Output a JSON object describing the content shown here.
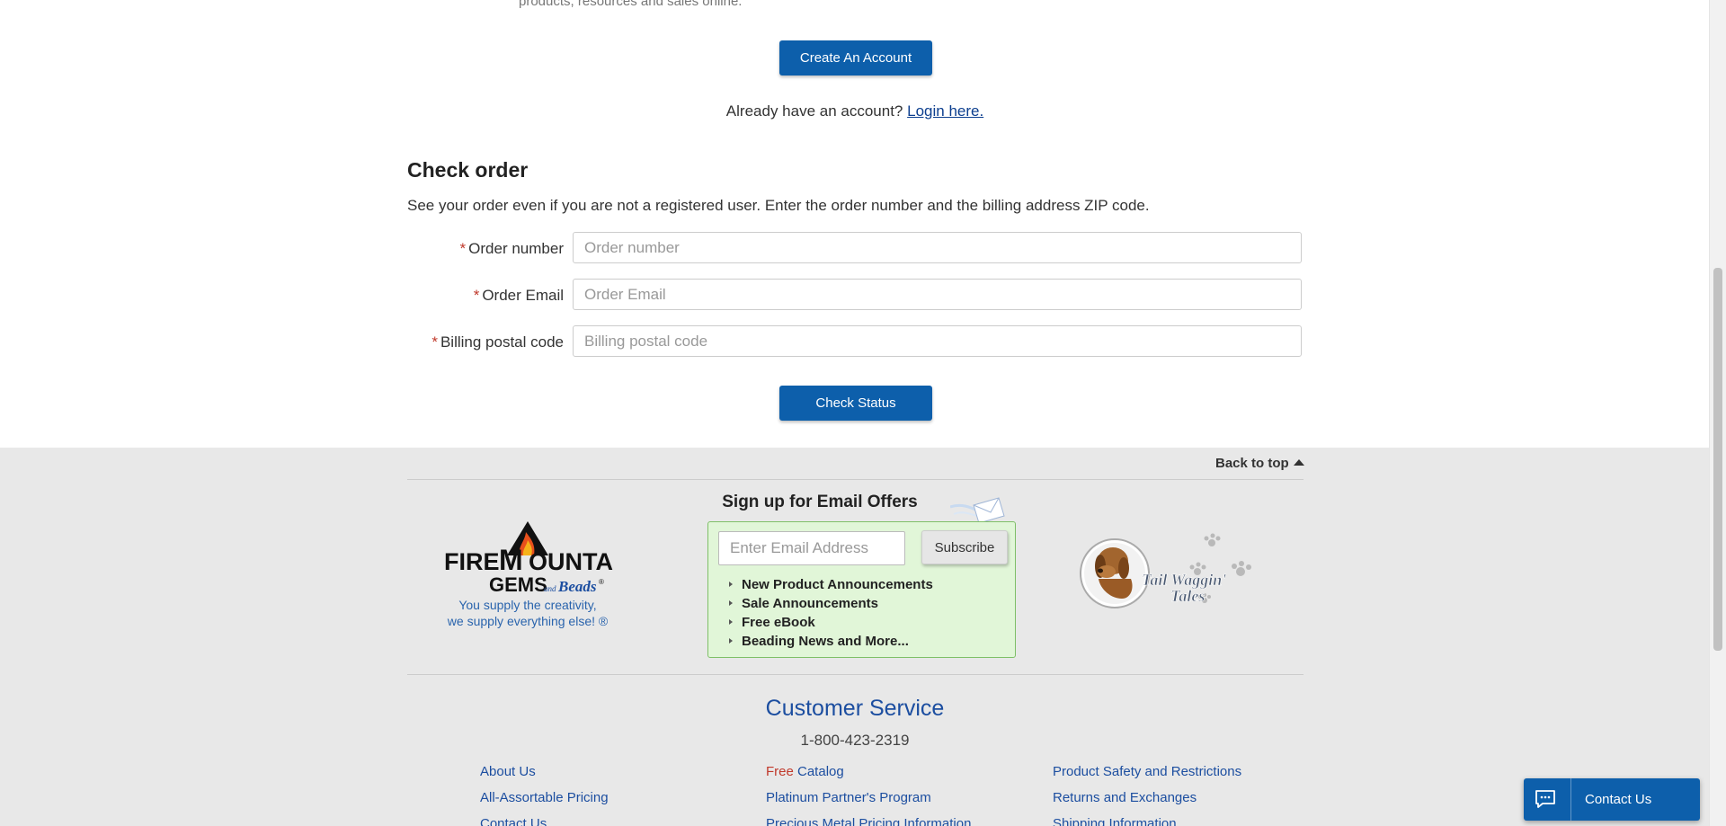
{
  "intro": {
    "text": "products, resources and sales online."
  },
  "account": {
    "create_button": "Create An Account",
    "already_text": "Already have an account?",
    "login_link": "Login here."
  },
  "check_order": {
    "title": "Check order",
    "description": "See your order even if you are not a registered user. Enter the order number and the billing address ZIP code.",
    "required_mark": "*",
    "fields": [
      {
        "label": "Order number",
        "placeholder": "Order number",
        "value": ""
      },
      {
        "label": "Order Email",
        "placeholder": "Order Email",
        "value": ""
      },
      {
        "label": "Billing postal code",
        "placeholder": "Billing postal code",
        "value": ""
      }
    ],
    "submit_button": "Check Status"
  },
  "footer": {
    "back_to_top": "Back to top",
    "logo": {
      "brand_line1_a": "FIRE",
      "brand_line1_b": "OUNTAIN",
      "brand_line2": "GEMS",
      "brand_and": "and",
      "brand_beads": "Beads",
      "tagline_1": "You supply the creativity,",
      "tagline_2": "we supply everything else! ®"
    },
    "signup": {
      "title": "Sign up for Email Offers",
      "email_placeholder": "Enter Email Address",
      "subscribe_button": "Subscribe",
      "benefits": [
        "New Product Announcements",
        "Sale Announcements",
        "Free eBook",
        "Beading News and More..."
      ]
    },
    "tail_waggin": {
      "line1": "Tail Waggin'",
      "line2": "Tales"
    },
    "customer_service": {
      "title": "Customer Service",
      "phone": "1-800-423-2319",
      "links_col1": [
        "About Us",
        "All-Assortable Pricing",
        "Contact Us"
      ],
      "links_col2": [
        {
          "prefix": "Free",
          "text": " Catalog"
        },
        {
          "prefix": "",
          "text": "Platinum Partner's Program"
        },
        {
          "prefix": "",
          "text": "Precious Metal Pricing Information"
        }
      ],
      "links_col3": [
        "Product Safety and Restrictions",
        "Returns and Exchanges",
        "Shipping Information"
      ]
    }
  },
  "chat_widget": {
    "label": "Contact Us"
  },
  "colors": {
    "primary_blue": "#0d5fab",
    "link_blue": "#1c4ea0",
    "required_red": "#c0392b",
    "signup_green_bg": "#e1f6d8",
    "footer_bg": "#e8e8e8"
  }
}
